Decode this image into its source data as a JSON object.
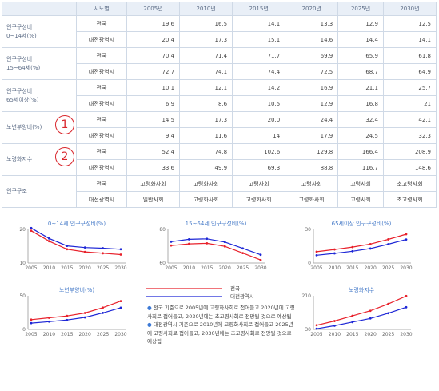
{
  "table": {
    "header": [
      "시도별",
      "2005년",
      "2010년",
      "2015년",
      "2020년",
      "2025년",
      "2030년"
    ],
    "groups": [
      {
        "label": "인구구성비\n0~14세(%)",
        "rows": [
          {
            "region": "전국",
            "values": [
              "19.6",
              "16.5",
              "14.1",
              "13.3",
              "12.9",
              "12.5"
            ]
          },
          {
            "region": "대전광역시",
            "values": [
              "20.4",
              "17.3",
              "15.1",
              "14.6",
              "14.4",
              "14.1"
            ]
          }
        ]
      },
      {
        "label": "인구구성비\n15~64세(%)",
        "rows": [
          {
            "region": "전국",
            "values": [
              "70.4",
              "71.4",
              "71.7",
              "69.9",
              "65.9",
              "61.8"
            ]
          },
          {
            "region": "대전광역시",
            "values": [
              "72.7",
              "74.1",
              "74.4",
              "72.5",
              "68.7",
              "64.9"
            ]
          }
        ]
      },
      {
        "label": "인구구성비\n65세이상(%)",
        "rows": [
          {
            "region": "전국",
            "values": [
              "10.1",
              "12.1",
              "14.2",
              "16.9",
              "21.1",
              "25.7"
            ]
          },
          {
            "region": "대전광역시",
            "values": [
              "6.9",
              "8.6",
              "10.5",
              "12.9",
              "16.8",
              "21"
            ]
          }
        ]
      },
      {
        "label": "노년부양비(%)",
        "marker": "1",
        "rows": [
          {
            "region": "전국",
            "values": [
              "14.5",
              "17.3",
              "20.0",
              "24.4",
              "32.4",
              "42.1"
            ]
          },
          {
            "region": "대전광역시",
            "values": [
              "9.4",
              "11.6",
              "14",
              "17.9",
              "24.5",
              "32.3"
            ]
          }
        ]
      },
      {
        "label": "노령화지수",
        "marker": "2",
        "rows": [
          {
            "region": "전국",
            "values": [
              "52.4",
              "74.8",
              "102.6",
              "129.8",
              "166.4",
              "208.9"
            ]
          },
          {
            "region": "대전광역시",
            "values": [
              "33.6",
              "49.9",
              "69.3",
              "88.8",
              "116.7",
              "148.6"
            ]
          }
        ]
      },
      {
        "label": "인구구조",
        "rows": [
          {
            "region": "전국",
            "values": [
              "고령화사회",
              "고령화사회",
              "고령사회",
              "고령사회",
              "고령사회",
              "초고령사회"
            ],
            "text": true
          },
          {
            "region": "대전광역시",
            "values": [
              "일반사회",
              "고령화사회",
              "고령화사회",
              "고령화사회",
              "고령사회",
              "초고령사회"
            ],
            "text": true
          }
        ]
      }
    ]
  },
  "colors": {
    "national": "#e8212b",
    "daejeon": "#1d26d6",
    "axis": "#999999",
    "title": "#4a7dc9"
  },
  "chart_data": [
    {
      "type": "line",
      "title": "0~14세 인구구성비(%)",
      "x": [
        2005,
        2010,
        2015,
        2020,
        2025,
        2030
      ],
      "ylim": [
        10,
        20
      ],
      "yticks": [
        10,
        20
      ],
      "series": [
        {
          "name": "전국",
          "values": [
            19.6,
            16.5,
            14.1,
            13.3,
            12.9,
            12.5
          ]
        },
        {
          "name": "대전광역시",
          "values": [
            20.4,
            17.3,
            15.1,
            14.6,
            14.4,
            14.1
          ]
        }
      ]
    },
    {
      "type": "line",
      "title": "15~64세 인구구성비(%)",
      "x": [
        2005,
        2010,
        2015,
        2020,
        2025,
        2030
      ],
      "ylim": [
        60,
        80
      ],
      "yticks": [
        60,
        80
      ],
      "series": [
        {
          "name": "전국",
          "values": [
            70.4,
            71.4,
            71.7,
            69.9,
            65.9,
            61.8
          ]
        },
        {
          "name": "대전광역시",
          "values": [
            72.7,
            74.1,
            74.4,
            72.5,
            68.7,
            64.9
          ]
        }
      ]
    },
    {
      "type": "line",
      "title": "65세이상 인구구성비(%)",
      "x": [
        2005,
        2010,
        2015,
        2020,
        2025,
        2030
      ],
      "ylim": [
        0,
        30
      ],
      "yticks": [
        0,
        30
      ],
      "series": [
        {
          "name": "전국",
          "values": [
            10.1,
            12.1,
            14.2,
            16.9,
            21.1,
            25.7
          ]
        },
        {
          "name": "대전광역시",
          "values": [
            6.9,
            8.6,
            10.5,
            12.9,
            16.8,
            21
          ]
        }
      ]
    },
    {
      "type": "line",
      "title": "노년부양비(%)",
      "x": [
        2005,
        2010,
        2015,
        2020,
        2025,
        2030
      ],
      "ylim": [
        0,
        50
      ],
      "yticks": [
        0,
        50
      ],
      "series": [
        {
          "name": "전국",
          "values": [
            14.5,
            17.3,
            20.0,
            24.4,
            32.4,
            42.1
          ]
        },
        {
          "name": "대전광역시",
          "values": [
            9.4,
            11.6,
            14,
            17.9,
            24.5,
            32.3
          ]
        }
      ]
    },
    {
      "type": "line",
      "title": "노령화지수",
      "x": [
        2005,
        2010,
        2015,
        2020,
        2025,
        2030
      ],
      "ylim": [
        30,
        210
      ],
      "yticks": [
        30,
        210
      ],
      "series": [
        {
          "name": "전국",
          "values": [
            52.4,
            74.8,
            102.6,
            129.8,
            166.4,
            208.9
          ]
        },
        {
          "name": "대전광역시",
          "values": [
            33.6,
            49.9,
            69.3,
            88.8,
            116.7,
            148.6
          ]
        }
      ]
    }
  ],
  "legend": {
    "national": "전국",
    "daejeon": "대전광역시"
  },
  "notes": [
    "전국 기준으로 2005년에 고령화사회로 접어들고 2020년에 고령사회로 접어들고, 2030년에는 초고령사회로 전망될 것으로 예상됨",
    "대전광역시 기준으로 2010년에 고령화사회로 접어들고 2025년에 고령사회로 접어들고, 2030년에는 초고령사회로 전망될 것으로 예상됨"
  ]
}
